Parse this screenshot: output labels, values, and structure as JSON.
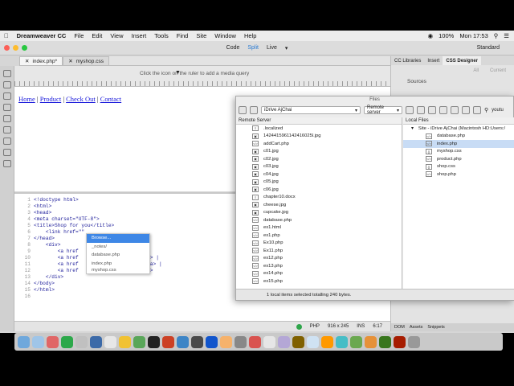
{
  "menubar": {
    "app": "Dreamweaver CC",
    "items": [
      "File",
      "Edit",
      "View",
      "Insert",
      "Tools",
      "Find",
      "Site",
      "Window",
      "Help"
    ],
    "battery": "100%",
    "clock": "Mon 17:53"
  },
  "titlebar": {
    "views": [
      "Code",
      "Split",
      "Live"
    ],
    "active_view": "Split",
    "workspace": "Standard"
  },
  "tabs": [
    {
      "label": "index.php*"
    },
    {
      "label": "myshop.css"
    }
  ],
  "ruler": {
    "hint": "Click the   icon on the ruler to add a media query"
  },
  "live": {
    "links": [
      "Home",
      "Product",
      "Check Out",
      "Contact"
    ],
    "separator": " | "
  },
  "code": {
    "lines": [
      {
        "n": "1",
        "text": "<!doctype html>"
      },
      {
        "n": "2",
        "text": "<html>"
      },
      {
        "n": "3",
        "text": "<head>"
      },
      {
        "n": "4",
        "text": "<meta charset=\"UTF-8\">"
      },
      {
        "n": "5",
        "text": "<title>Shop for you</title>"
      },
      {
        "n": "6",
        "text": "    <link href=\"\""
      },
      {
        "n": "7",
        "text": "</head>"
      },
      {
        "n": "8",
        "text": "    <div>"
      },
      {
        "n": "9",
        "text": "        <a href                  a> |"
      },
      {
        "n": "10",
        "text": "        <a href                  ct </a> |"
      },
      {
        "n": "11",
        "text": "        <a href                   Out</a> |"
      },
      {
        "n": "12",
        "text": "        <a href                  ct </a>"
      },
      {
        "n": "13",
        "text": "    </div>"
      },
      {
        "n": "14",
        "text": "</body>"
      },
      {
        "n": "15",
        "text": "</html>"
      },
      {
        "n": "16",
        "text": ""
      }
    ],
    "hint_items": [
      "Browse...",
      "_notes/",
      "database.php",
      "index.php",
      "myshop.css"
    ]
  },
  "statusbar": {
    "language": "PHP",
    "size": "916 x 245",
    "mode": "INS",
    "position": "6:17"
  },
  "rightpanel": {
    "tabs": [
      "CC Libraries",
      "Insert",
      "CSS Designer"
    ],
    "active": "CSS Designer",
    "buttons": [
      "All",
      "Current"
    ],
    "section": "Sources",
    "bottom_tabs": [
      "DOM",
      "Assets",
      "Snippets"
    ]
  },
  "files": {
    "title": "Files",
    "site": "iDrive AjChai",
    "server": "Remote server",
    "search": "youtu",
    "remote_header": "Remote Server",
    "local_header": "Local Files",
    "remote": [
      {
        "icon": "doc",
        "name": ".localized"
      },
      {
        "icon": "img",
        "name": "1424415961142416025l.jpg"
      },
      {
        "icon": "code",
        "name": "addCart.php"
      },
      {
        "icon": "img",
        "name": "c01.jpg"
      },
      {
        "icon": "img",
        "name": "c02.jpg"
      },
      {
        "icon": "img",
        "name": "c03.jpg"
      },
      {
        "icon": "img",
        "name": "c04.jpg"
      },
      {
        "icon": "img",
        "name": "c05.jpg"
      },
      {
        "icon": "img",
        "name": "c06.jpg"
      },
      {
        "icon": "doc",
        "name": "chapter10.docx"
      },
      {
        "icon": "img",
        "name": "cheese.jpg"
      },
      {
        "icon": "img",
        "name": "cupcake.jpg"
      },
      {
        "icon": "code",
        "name": "database.php"
      },
      {
        "icon": "code",
        "name": "ex1.html"
      },
      {
        "icon": "code",
        "name": "ex1.php"
      },
      {
        "icon": "code",
        "name": "Ex10.php"
      },
      {
        "icon": "code",
        "name": "Ex11.php"
      },
      {
        "icon": "code",
        "name": "ex12.php"
      },
      {
        "icon": "code",
        "name": "ex13.php"
      },
      {
        "icon": "code",
        "name": "ex14.php"
      },
      {
        "icon": "code",
        "name": "ex15.php"
      }
    ],
    "local_root": "Site - iDrive AjChai (Macintosh HD:Users:/",
    "local": [
      {
        "icon": "code",
        "name": "database.php",
        "selected": false
      },
      {
        "icon": "code",
        "name": "index.php",
        "selected": true
      },
      {
        "icon": "css",
        "name": "myshop.css",
        "selected": false
      },
      {
        "icon": "code",
        "name": "product.php",
        "selected": false
      },
      {
        "icon": "css",
        "name": "shop.css",
        "selected": false
      },
      {
        "icon": "code",
        "name": "shop.php",
        "selected": false
      }
    ],
    "status": "1 local items selected totalling 240 bytes."
  },
  "dock": {
    "colors": [
      "#6fa8dc",
      "#9fc5e8",
      "#e06666",
      "#2ca84a",
      "#c0c0c0",
      "#3c6aa8",
      "#e7e7e7",
      "#f1c232",
      "#59a659",
      "#222222",
      "#cc4125",
      "#3d85c6",
      "#4a4a4a",
      "#1155cc",
      "#f6b26b",
      "#888888",
      "#d9534f",
      "#e6e6e6",
      "#b4a7d6",
      "#7f6000",
      "#cfe2f3",
      "#ff9900",
      "#46bdc6",
      "#6aa84f",
      "#e69138",
      "#38761d",
      "#a61c00",
      "#999999"
    ]
  }
}
